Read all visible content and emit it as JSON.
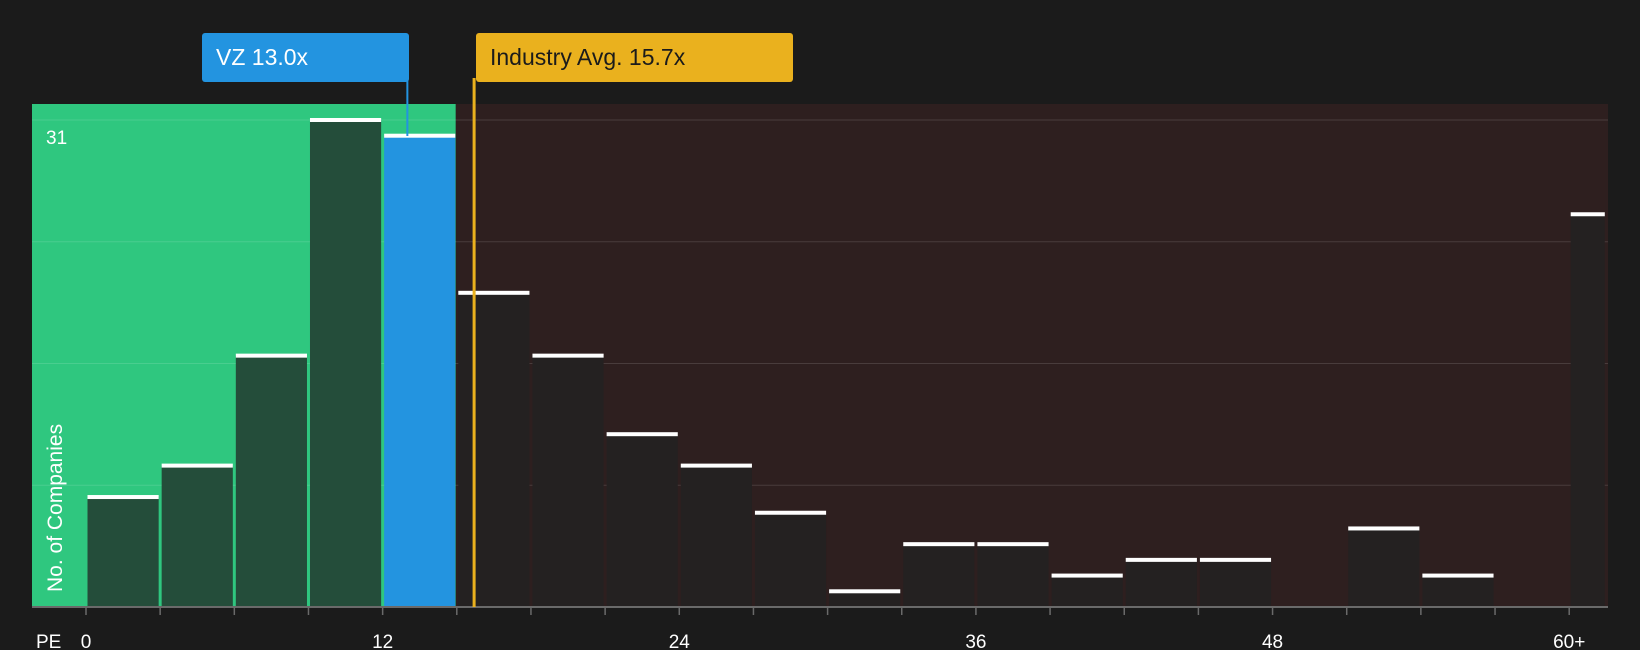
{
  "colors": {
    "background": "#1b1b1b",
    "undervalued_zone": "#2fc77f",
    "overvalued_zone": "#2e1f1f",
    "bar_in_green": "#244d3a",
    "bar_in_dark": "#242121",
    "bar_highlight": "#2394e0",
    "company_marker": "#2394e0",
    "industry_marker": "#eab11e"
  },
  "callouts": {
    "company": "VZ 13.0x",
    "industry": "Industry Avg. 15.7x"
  },
  "chart_data": {
    "type": "bar",
    "ylabel": "No. of Companies",
    "xlabel": "PE",
    "y_max_label": "31",
    "ylim": [
      0,
      31
    ],
    "x_ticks": [
      {
        "value": 0,
        "label": "0"
      },
      {
        "value": 12,
        "label": "12"
      },
      {
        "value": 24,
        "label": "24"
      },
      {
        "value": 36,
        "label": "36"
      },
      {
        "value": 48,
        "label": "48"
      },
      {
        "value": 60,
        "label": "60+"
      }
    ],
    "bin_width": 3,
    "bins": [
      {
        "start": 0,
        "end": 3,
        "count": 7
      },
      {
        "start": 3,
        "end": 6,
        "count": 9
      },
      {
        "start": 6,
        "end": 9,
        "count": 16
      },
      {
        "start": 9,
        "end": 12,
        "count": 31
      },
      {
        "start": 12,
        "end": 15,
        "count": 30,
        "highlight": true
      },
      {
        "start": 15,
        "end": 18,
        "count": 20
      },
      {
        "start": 18,
        "end": 21,
        "count": 16
      },
      {
        "start": 21,
        "end": 24,
        "count": 11
      },
      {
        "start": 24,
        "end": 27,
        "count": 9
      },
      {
        "start": 27,
        "end": 30,
        "count": 6
      },
      {
        "start": 30,
        "end": 33,
        "count": 1
      },
      {
        "start": 33,
        "end": 36,
        "count": 4
      },
      {
        "start": 36,
        "end": 39,
        "count": 4
      },
      {
        "start": 39,
        "end": 42,
        "count": 2
      },
      {
        "start": 42,
        "end": 45,
        "count": 3
      },
      {
        "start": 45,
        "end": 48,
        "count": 3
      },
      {
        "start": 48,
        "end": 51,
        "count": 0
      },
      {
        "start": 51,
        "end": 54,
        "count": 5
      },
      {
        "start": 54,
        "end": 57,
        "count": 2
      },
      {
        "start": 57,
        "end": 60,
        "count": 0
      },
      {
        "start": 60,
        "end": 61.5,
        "count": 25
      }
    ],
    "company": {
      "ticker": "VZ",
      "pe": 13.0
    },
    "industry_avg_pe": 15.7,
    "green_zone_end_pe": 15.0,
    "grid": true
  }
}
